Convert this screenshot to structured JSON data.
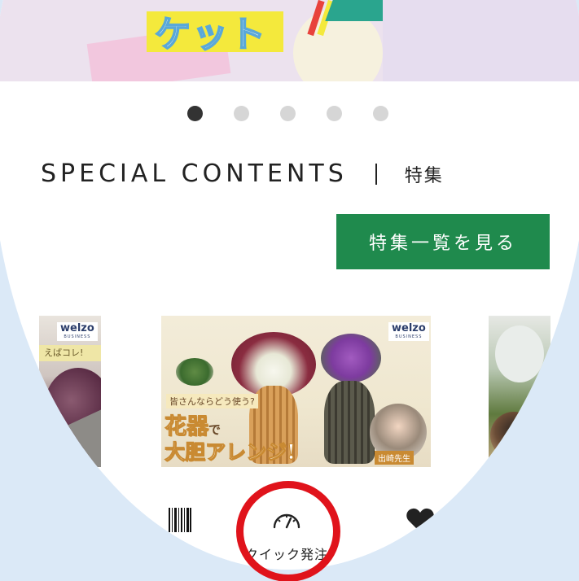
{
  "hero": {
    "text": "ケット"
  },
  "carousel_dots": {
    "count": 5,
    "active_index": 0
  },
  "special": {
    "heading_en": "SPECIAL CONTENTS",
    "separator": "|",
    "heading_ja": "特集",
    "view_all_label": "特集一覧を見る",
    "button_color": "#1f8a4d"
  },
  "cards": {
    "left": {
      "logo": "welzo",
      "logo_sub": "BUSINESS",
      "tag": "えばコレ!"
    },
    "main": {
      "logo": "welzo",
      "logo_sub": "BUSINESS",
      "tag": "皆さんならどう使う?",
      "headline_1": "花器",
      "headline_1_suffix": "で",
      "headline_2": "大胆アレンジ!",
      "person_name": "出崎先生"
    },
    "right": {}
  },
  "nav": {
    "scan_label": "ャン",
    "quick_order_label": "クイック発注",
    "favorites_label": "お気に"
  },
  "annotation": {
    "color": "#e0131b"
  }
}
